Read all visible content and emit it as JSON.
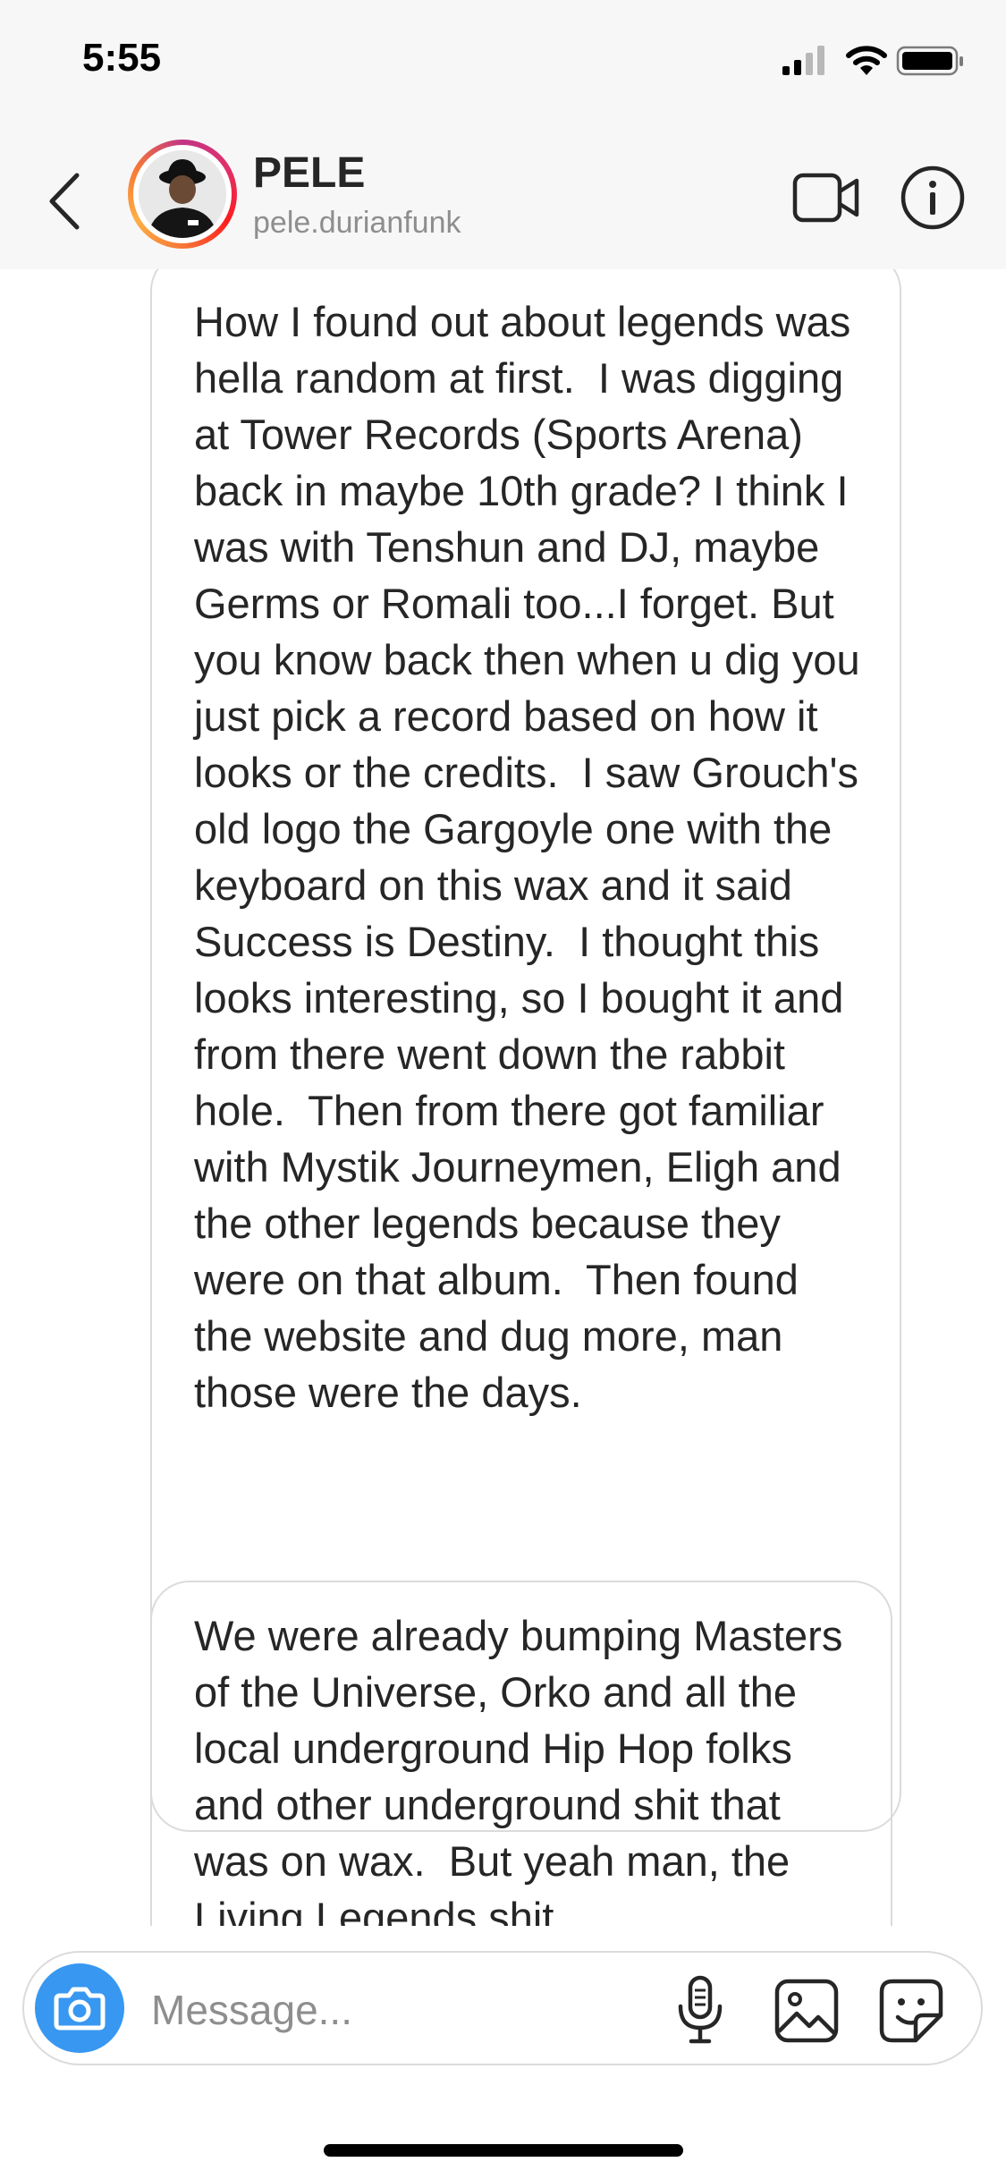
{
  "status_bar": {
    "time": "5:55",
    "icons": [
      "signal-icon",
      "wifi-icon",
      "battery-icon"
    ]
  },
  "header": {
    "back_icon": "chevron-left-icon",
    "name": "PELE",
    "username": "pele.durianfunk",
    "video_icon": "video-camera-icon",
    "info_icon": "info-icon"
  },
  "messages": [
    {
      "text": "How I found out about legends was hella random at first.  I was digging at Tower Records (Sports Arena) back in maybe 10th grade? I think I was with Tenshun and DJ, maybe Germs or Romali too...I forget. But you know back then when u dig you just pick a record based on how it looks or the credits.  I saw Grouch's old logo the Gargoyle one with the keyboard on this wax and it said Success is Destiny.  I thought this looks interesting, so I bought it and from there went down the rabbit hole.  Then from there got familiar with Mystik Journeymen, Eligh and the other legends because they were on that album.  Then found the website and dug more, man those were the days."
    },
    {
      "text": "We were already bumping Masters of the Universe, Orko and all the local underground Hip Hop folks and other underground shit that was on wax.  But yeah man, the Living Legends shit"
    }
  ],
  "composer": {
    "placeholder": "Message...",
    "camera_icon": "camera-icon",
    "mic_icon": "microphone-icon",
    "gallery_icon": "gallery-icon",
    "sticker_icon": "sticker-icon"
  },
  "colors": {
    "accent": "#3897f0",
    "border": "#dbdbdb",
    "text": "#262626",
    "secondary_text": "#8e8e8e",
    "header_bg": "#f7f7f7"
  }
}
